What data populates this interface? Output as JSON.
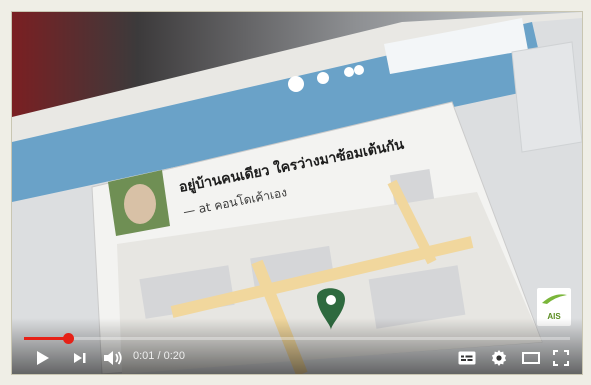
{
  "video": {
    "post_text": "อยู่บ้านคนเดียว ใครว่างมาซ้อมเต้นกัน",
    "checkin_text": "— at คอนโดเค้าเอง",
    "watermark_label": "AIS"
  },
  "player": {
    "time_display": "0:01 / 0:20",
    "progress": 0.08,
    "colors": {
      "progress": "#e62117",
      "controls": "#ffffff"
    },
    "icons": [
      "play-icon",
      "next-icon",
      "volume-icon",
      "subtitles-icon",
      "settings-icon",
      "theater-icon",
      "fullscreen-icon"
    ]
  }
}
